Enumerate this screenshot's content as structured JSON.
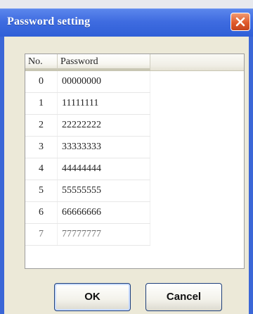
{
  "window": {
    "title": "Password setting"
  },
  "table": {
    "headers": [
      "No.",
      "Password"
    ],
    "rows": [
      {
        "no": "0",
        "password": "00000000"
      },
      {
        "no": "1",
        "password": "11111111"
      },
      {
        "no": "2",
        "password": "22222222"
      },
      {
        "no": "3",
        "password": "33333333"
      },
      {
        "no": "4",
        "password": "44444444"
      },
      {
        "no": "5",
        "password": "55555555"
      },
      {
        "no": "6",
        "password": "66666666"
      },
      {
        "no": "7",
        "password": "77777777"
      }
    ]
  },
  "buttons": {
    "ok_label": "OK",
    "cancel_label": "Cancel"
  },
  "icons": {
    "close": "close-icon"
  },
  "colors": {
    "titlebar": "#3f6ce0",
    "close_button": "#e05b2d",
    "dialog_background": "#ece9d8"
  }
}
